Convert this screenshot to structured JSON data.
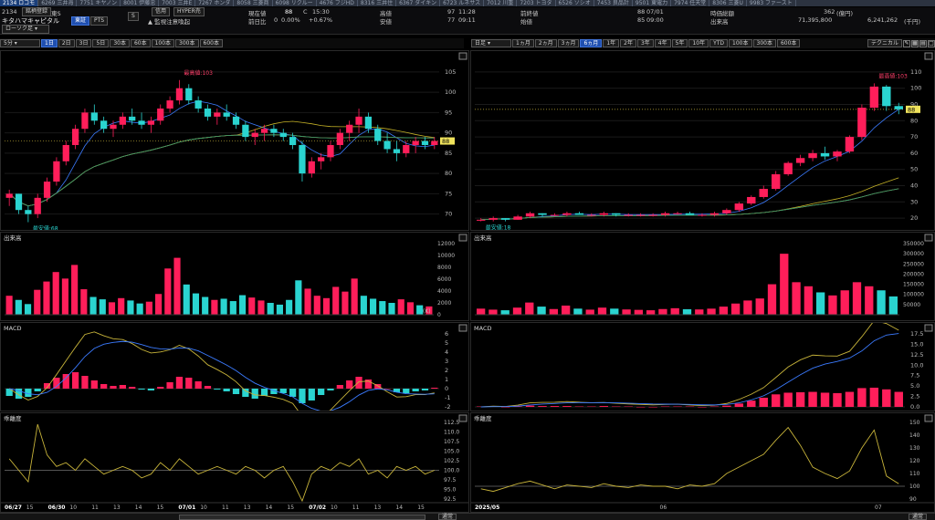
{
  "ticker_strip": [
    "2134 ロコモ",
    "6269 三井海",
    "7751 キヤノン",
    "8001 伊藤忠",
    "7003 三井E",
    "7267 ホンダ",
    "8058 三菱商",
    "6098 リクルー",
    "4676 フジHD",
    "8316 三井住",
    "6367 ダイキン",
    "6723 ルネサス",
    "7012 川重",
    "7203 トヨタ",
    "6526 ソシオ",
    "7453 良品計",
    "9501 東電力",
    "7974 任天堂",
    "8306 三菱U",
    "9983 ファースト"
  ],
  "stock": {
    "code": "2134",
    "name": "キタハマキャピタル",
    "exchange": "東S",
    "tabs": [
      "東証",
      "PTS"
    ],
    "warning": "監視注意喚起",
    "register_btn": "銘柄登録"
  },
  "tags": [
    "信用",
    "HYPER売"
  ],
  "badge_s": "S",
  "quote": {
    "cur_label": "現在値",
    "cur_value": "88",
    "cur_mark": "C",
    "cur_time": "15:30",
    "prev_label": "前日比",
    "prev_value": "0",
    "prev_pct": "0.00%",
    "prev_extra": "+0.67%",
    "high_label": "高値",
    "high_value": "97",
    "high_time": "11:28",
    "low_label": "安値",
    "low_value": "77",
    "low_time": "09:11",
    "open_label": "前終値",
    "open_value": "88",
    "open_date": "07/01",
    "start_label": "始値",
    "start_value": "85",
    "start_time": "09:00",
    "vol_label": "出来高",
    "mcap_label": "時価総額",
    "mcap_value": "362",
    "mcap_unit": "(億円)",
    "vol_value": "71,395,800",
    "turnover_value": "6,241,262",
    "turnover_unit": "(千円)"
  },
  "left": {
    "chart_select": "ローソク足",
    "interval": "5分",
    "periods": [
      "1日",
      "2日",
      "3日",
      "5日",
      "30本",
      "60本",
      "100本",
      "300本",
      "600本"
    ],
    "active_period": "1日",
    "high_tag": "最高値:103",
    "low_tag": "最安値:68",
    "price_tag": "88",
    "y_ticks": [
      "105",
      "100",
      "95",
      "90",
      "85",
      "80",
      "75",
      "70"
    ],
    "vol_label": "出来高",
    "vol_unit": "(K)",
    "vol_ticks": [
      "12000",
      "10000",
      "8000",
      "6000",
      "4000",
      "2000",
      "0"
    ],
    "macd_label": "MACD",
    "macd_ticks": [
      "6",
      "5",
      "4",
      "3",
      "2",
      "1",
      "0",
      "-1",
      "-2"
    ],
    "osc_label": "乖離度",
    "osc_ticks": [
      "112.5",
      "110.0",
      "107.5",
      "105.0",
      "102.5",
      "100.0",
      "97.5",
      "95.0",
      "92.5"
    ],
    "x_labels": [
      "06/27",
      "15",
      "06/30",
      "10",
      "11",
      "13",
      "14",
      "15",
      "07/01",
      "10",
      "11",
      "13",
      "14",
      "15",
      "07/02",
      "10",
      "11",
      "13",
      "14",
      "15"
    ],
    "menu_label": "通常"
  },
  "right": {
    "chart_select": "日足",
    "periods": [
      "1ヵ月",
      "2ヵ月",
      "3ヵ月",
      "6ヵ月",
      "1年",
      "2年",
      "3年",
      "4年",
      "5年",
      "10年",
      "YTD",
      "100本",
      "300本",
      "600本"
    ],
    "active_period": "6ヵ月",
    "tech_btn": "テクニカル",
    "high_tag": "最高値:103",
    "low_tag": "最安値:18",
    "price_tag": "88",
    "y_ticks": [
      "110",
      "100",
      "90",
      "80",
      "70",
      "60",
      "50",
      "40",
      "30",
      "20"
    ],
    "vol_label": "出来高",
    "vol_ticks": [
      "350000",
      "300000",
      "250000",
      "200000",
      "150000",
      "100000",
      "50000"
    ],
    "macd_label": "MACD",
    "macd_ticks": [
      "17.5",
      "15.0",
      "12.5",
      "10.0",
      "7.5",
      "5.0",
      "2.5",
      "0.0"
    ],
    "osc_label": "乖離度",
    "osc_ticks": [
      "150",
      "140",
      "130",
      "120",
      "110",
      "100",
      "90"
    ],
    "x_labels": [
      "2025/05",
      "06",
      "07"
    ],
    "menu_label": "通常"
  },
  "chart_data": [
    {
      "type": "candlestick",
      "title": "キタハマキャピタル 5分足",
      "ylim": [
        67,
        107
      ],
      "ohlc": [
        [
          74,
          76,
          72,
          75
        ],
        [
          75,
          75,
          70,
          71
        ],
        [
          71,
          72,
          68,
          70
        ],
        [
          70,
          75,
          69,
          74
        ],
        [
          74,
          79,
          73,
          78
        ],
        [
          78,
          84,
          77,
          83
        ],
        [
          83,
          88,
          82,
          87
        ],
        [
          87,
          92,
          86,
          91
        ],
        [
          91,
          96,
          90,
          95
        ],
        [
          95,
          97,
          92,
          93
        ],
        [
          93,
          94,
          90,
          91
        ],
        [
          91,
          93,
          89,
          92
        ],
        [
          92,
          95,
          91,
          94
        ],
        [
          94,
          96,
          92,
          93
        ],
        [
          93,
          95,
          91,
          92
        ],
        [
          92,
          94,
          90,
          93
        ],
        [
          93,
          97,
          92,
          96
        ],
        [
          96,
          99,
          95,
          98
        ],
        [
          98,
          103,
          97,
          101
        ],
        [
          101,
          102,
          97,
          98
        ],
        [
          98,
          99,
          95,
          96
        ],
        [
          96,
          97,
          93,
          94
        ],
        [
          94,
          96,
          92,
          95
        ],
        [
          95,
          97,
          93,
          94
        ],
        [
          94,
          95,
          91,
          92
        ],
        [
          92,
          93,
          88,
          89
        ],
        [
          89,
          91,
          87,
          90
        ],
        [
          90,
          92,
          88,
          91
        ],
        [
          91,
          92,
          89,
          90
        ],
        [
          90,
          91,
          88,
          89
        ],
        [
          89,
          90,
          86,
          87
        ],
        [
          87,
          88,
          78,
          80
        ],
        [
          80,
          84,
          79,
          83
        ],
        [
          83,
          85,
          81,
          84
        ],
        [
          84,
          88,
          83,
          87
        ],
        [
          87,
          91,
          86,
          90
        ],
        [
          90,
          93,
          88,
          92
        ],
        [
          92,
          96,
          90,
          94
        ],
        [
          94,
          95,
          90,
          91
        ],
        [
          91,
          92,
          87,
          88
        ],
        [
          88,
          90,
          85,
          86
        ],
        [
          86,
          88,
          83,
          85
        ],
        [
          85,
          88,
          84,
          87
        ],
        [
          87,
          89,
          85,
          88
        ],
        [
          88,
          89,
          86,
          87
        ],
        [
          87,
          89,
          86,
          88
        ]
      ],
      "volume_k": [
        3200,
        2500,
        1800,
        4200,
        5600,
        7200,
        6100,
        8400,
        4300,
        3000,
        2600,
        2100,
        2800,
        2400,
        1900,
        2200,
        3500,
        7800,
        9600,
        5100,
        3600,
        3000,
        2500,
        2700,
        2300,
        3300,
        2900,
        2400,
        2000,
        1700,
        2500,
        5800,
        4400,
        3200,
        2800,
        4700,
        3900,
        6100,
        3200,
        2700,
        2300,
        2000,
        2600,
        2100,
        1600,
        1400
      ],
      "macd_hist": [
        -0.8,
        -1.1,
        -0.9,
        -0.3,
        0.6,
        1.2,
        1.6,
        1.8,
        1.4,
        0.9,
        0.5,
        0.3,
        0.4,
        0.2,
        -0.1,
        -0.2,
        0.2,
        0.7,
        1.3,
        1.2,
        0.8,
        0.3,
        -0.1,
        -0.3,
        -0.6,
        -0.9,
        -1.1,
        -0.8,
        -0.6,
        -0.5,
        -0.9,
        -1.6,
        -1.3,
        -0.7,
        -0.2,
        0.4,
        0.9,
        1.3,
        1.0,
        0.5,
        0.0,
        -0.4,
        -0.5,
        -0.3,
        -0.2,
        0.1
      ],
      "osc": [
        103,
        100,
        97,
        112,
        104,
        101,
        102,
        100,
        103,
        101,
        99,
        100,
        101,
        100,
        98,
        99,
        102,
        100,
        103,
        101,
        99,
        100,
        101,
        100,
        99,
        101,
        100,
        98,
        100,
        101,
        97,
        92,
        99,
        101,
        100,
        102,
        101,
        103,
        99,
        100,
        98,
        101,
        100,
        101,
        99,
        100
      ]
    },
    {
      "type": "candlestick",
      "title": "キタハマキャピタル 日足",
      "ylim": [
        15,
        115
      ],
      "ohlc": [
        [
          19,
          20,
          18,
          19
        ],
        [
          19,
          21,
          18,
          20
        ],
        [
          20,
          20,
          18,
          19
        ],
        [
          19,
          22,
          19,
          21
        ],
        [
          21,
          24,
          20,
          23
        ],
        [
          23,
          23,
          21,
          22
        ],
        [
          22,
          23,
          21,
          22
        ],
        [
          22,
          24,
          21,
          23
        ],
        [
          23,
          24,
          22,
          22
        ],
        [
          22,
          23,
          21,
          22
        ],
        [
          22,
          24,
          21,
          23
        ],
        [
          23,
          23,
          21,
          22
        ],
        [
          22,
          23,
          21,
          22
        ],
        [
          22,
          23,
          21,
          22
        ],
        [
          22,
          23,
          21,
          22
        ],
        [
          22,
          24,
          21,
          23
        ],
        [
          23,
          24,
          22,
          23
        ],
        [
          23,
          24,
          22,
          22
        ],
        [
          22,
          23,
          21,
          22
        ],
        [
          22,
          24,
          21,
          23
        ],
        [
          23,
          26,
          22,
          25
        ],
        [
          25,
          30,
          24,
          29
        ],
        [
          29,
          34,
          28,
          33
        ],
        [
          33,
          40,
          32,
          38
        ],
        [
          38,
          49,
          37,
          47
        ],
        [
          47,
          55,
          46,
          54
        ],
        [
          54,
          59,
          52,
          57
        ],
        [
          57,
          62,
          55,
          60
        ],
        [
          60,
          64,
          56,
          58
        ],
        [
          58,
          62,
          55,
          61
        ],
        [
          61,
          71,
          60,
          70
        ],
        [
          70,
          90,
          68,
          88
        ],
        [
          88,
          103,
          86,
          101
        ],
        [
          101,
          102,
          86,
          89
        ],
        [
          89,
          91,
          84,
          87
        ]
      ],
      "volume": [
        30000,
        25000,
        22000,
        35000,
        60000,
        40000,
        28000,
        45000,
        30000,
        25000,
        35000,
        30000,
        26000,
        24000,
        22000,
        28000,
        32000,
        27000,
        26000,
        30000,
        40000,
        55000,
        70000,
        80000,
        150000,
        300000,
        160000,
        140000,
        110000,
        95000,
        120000,
        160000,
        140000,
        120000,
        90000
      ],
      "macd_hist": [
        0.1,
        0.1,
        0.0,
        0.1,
        0.3,
        0.2,
        0.2,
        0.2,
        0.1,
        0.1,
        0.2,
        0.1,
        0.1,
        0.0,
        0.0,
        0.1,
        0.1,
        0.1,
        0.0,
        0.1,
        0.3,
        0.8,
        1.5,
        2.2,
        3.0,
        3.4,
        3.5,
        3.6,
        3.4,
        3.3,
        3.6,
        4.5,
        4.6,
        4.2,
        3.6
      ],
      "osc": [
        98,
        96,
        99,
        102,
        104,
        101,
        98,
        101,
        100,
        99,
        102,
        100,
        99,
        101,
        100,
        100,
        98,
        101,
        100,
        102,
        110,
        115,
        120,
        125,
        136,
        146,
        132,
        115,
        110,
        106,
        112,
        130,
        144,
        108,
        102
      ]
    }
  ]
}
